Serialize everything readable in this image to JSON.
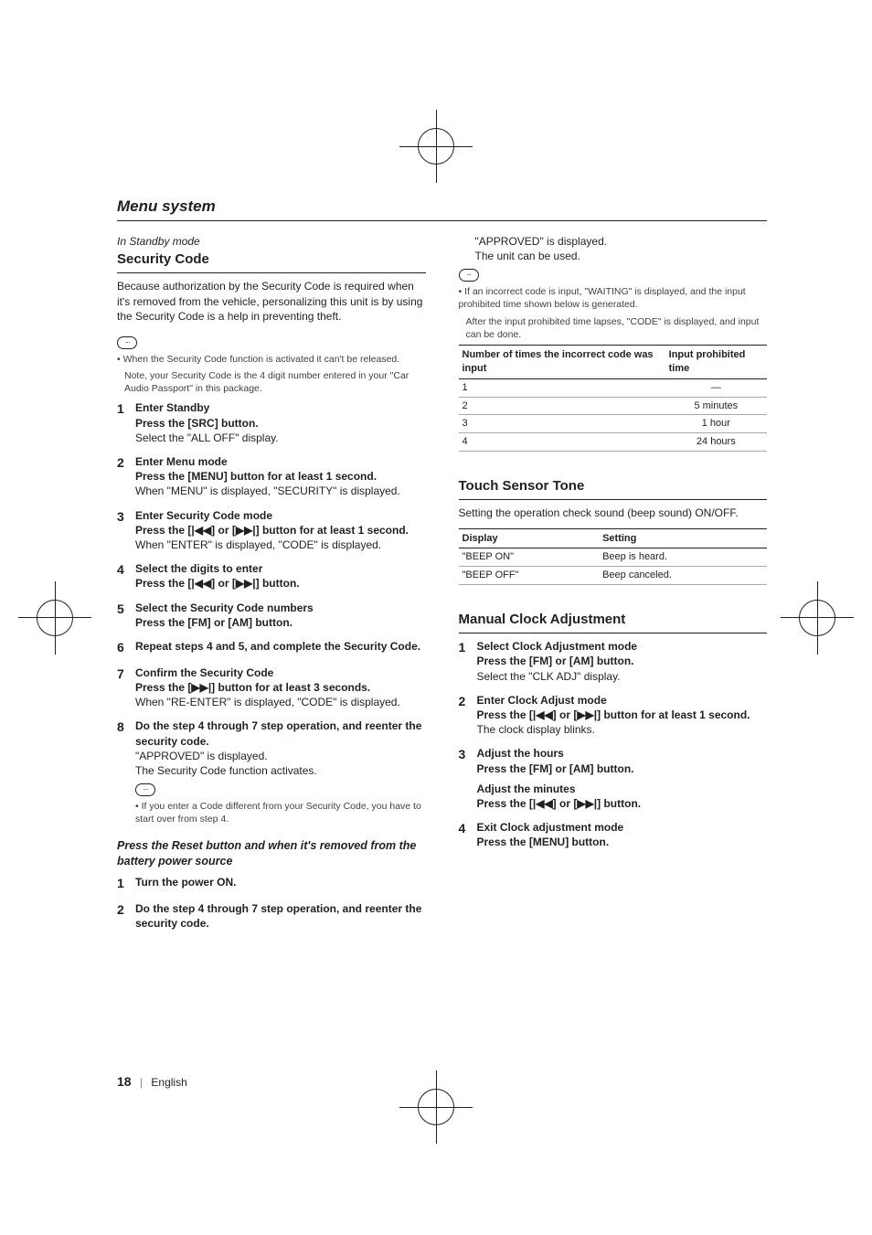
{
  "section_title": "Menu system",
  "footer": {
    "page_number": "18",
    "language": "English"
  },
  "left": {
    "mode_note": "In Standby mode",
    "feature_title": "Security Code",
    "intro": "Because authorization by the Security Code is required when it's removed from the vehicle, personalizing this unit is by using the Security Code is a help in preventing theft.",
    "icon_label": "···",
    "note1": "When the Security Code function is activated it can't be released.",
    "note2": "Note, your Security Code is the 4 digit number entered in your \"Car Audio Passport\" in this package.",
    "steps": [
      {
        "n": "1",
        "title": "Enter Standby",
        "instr": "Press the [SRC] button.",
        "plain": "Select the \"ALL OFF\" display."
      },
      {
        "n": "2",
        "title": "Enter Menu mode",
        "instr": "Press the [MENU] button for at least 1 second.",
        "plain": "When \"MENU\" is displayed, \"SECURITY\" is displayed."
      },
      {
        "n": "3",
        "title": "Enter Security Code mode",
        "instr": "Press the [|◀◀] or [▶▶|] button for at least 1 second.",
        "plain": "When \"ENTER\" is displayed, \"CODE\" is displayed."
      },
      {
        "n": "4",
        "title": "Select the digits to enter",
        "instr": "Press the [|◀◀] or [▶▶|] button.",
        "plain": ""
      },
      {
        "n": "5",
        "title": "Select the Security Code numbers",
        "instr": "Press the [FM] or [AM] button.",
        "plain": ""
      },
      {
        "n": "6",
        "title": "Repeat steps 4 and 5, and complete the Security Code.",
        "instr": "",
        "plain": ""
      },
      {
        "n": "7",
        "title": "Confirm the Security Code",
        "instr": "Press the [▶▶|] button for at least 3 seconds.",
        "plain": "When \"RE-ENTER\" is displayed, \"CODE\" is displayed."
      },
      {
        "n": "8",
        "title": "Do the step 4 through 7 step operation, and reenter the security code.",
        "instr": "",
        "plain": "\"APPROVED\" is displayed.\nThe Security Code function activates."
      }
    ],
    "after8_icon_label": "···",
    "after8_note": "If you enter a Code different from your Security Code, you have to start over from step 4.",
    "reset_heading": "Press the Reset button and when it's removed from the battery power source",
    "reset_steps": [
      {
        "n": "1",
        "title": "Turn the power ON."
      },
      {
        "n": "2",
        "title": "Do the step 4 through 7 step operation, and reenter the security code."
      }
    ]
  },
  "right": {
    "cont_line1": "\"APPROVED\" is displayed.",
    "cont_line2": "The unit can be used.",
    "icon_label": "···",
    "note_para1": "If an incorrect code is input, \"WAITING\" is displayed, and the input prohibited time shown below is generated.",
    "note_para2": "After the input prohibited time lapses, \"CODE\" is displayed, and input can be done.",
    "table1": {
      "head": [
        "Number of times the incorrect code was input",
        "Input prohibited time"
      ],
      "rows": [
        [
          "1",
          "—"
        ],
        [
          "2",
          "5 minutes"
        ],
        [
          "3",
          "1 hour"
        ],
        [
          "4",
          "24 hours"
        ]
      ]
    },
    "touch": {
      "title": "Touch Sensor Tone",
      "intro": "Setting the operation check sound (beep sound) ON/OFF.",
      "head": [
        "Display",
        "Setting"
      ],
      "rows": [
        [
          "\"BEEP ON\"",
          "Beep is heard."
        ],
        [
          "\"BEEP OFF\"",
          "Beep canceled."
        ]
      ]
    },
    "clock": {
      "title": "Manual Clock Adjustment",
      "steps": [
        {
          "n": "1",
          "title": "Select Clock Adjustment mode",
          "instr": "Press the [FM] or [AM] button.",
          "plain": "Select the \"CLK ADJ\" display."
        },
        {
          "n": "2",
          "title": "Enter Clock Adjust mode",
          "instr": "Press the [|◀◀] or [▶▶|] button for at least 1 second.",
          "plain": "The clock display blinks."
        },
        {
          "n": "3",
          "title": "Adjust the hours",
          "instr": "Press the [FM] or [AM] button.",
          "plain": "",
          "title2": "Adjust the minutes",
          "instr2": "Press the [|◀◀] or [▶▶|] button."
        },
        {
          "n": "4",
          "title": "Exit Clock adjustment mode",
          "instr": "Press the [MENU] button.",
          "plain": ""
        }
      ]
    }
  }
}
